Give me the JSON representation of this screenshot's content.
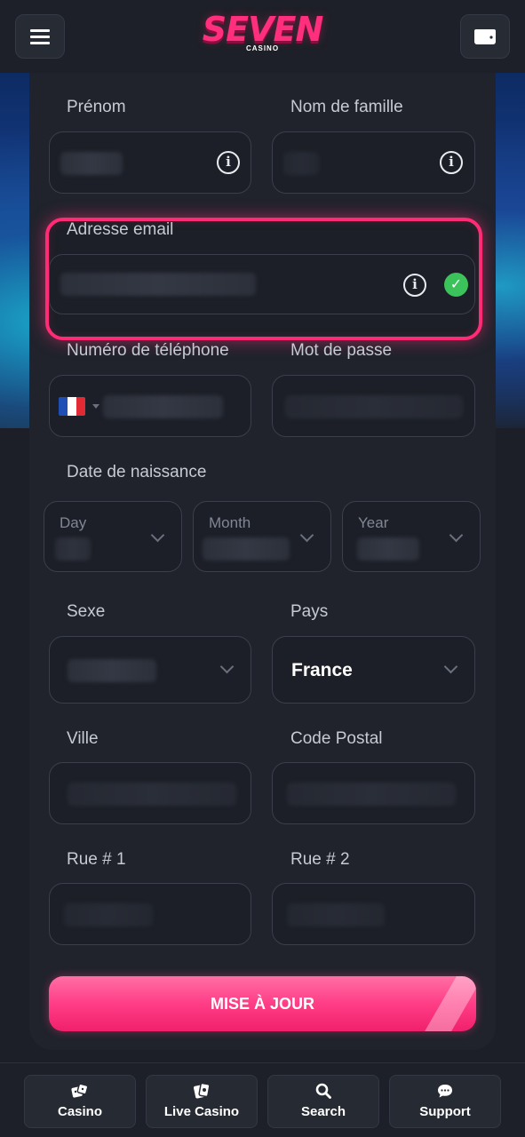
{
  "header": {
    "logo_main": "SEVEN",
    "logo_sub": "CASINO",
    "menu_icon": "hamburger-icon",
    "wallet_icon": "wallet-icon"
  },
  "form": {
    "first_name_label": "Prénom",
    "last_name_label": "Nom de famille",
    "email_label": "Adresse email",
    "phone_label": "Numéro de téléphone",
    "password_label": "Mot de passe",
    "dob_label": "Date de naissance",
    "day_label": "Day",
    "month_label": "Month",
    "year_label": "Year",
    "sex_label": "Sexe",
    "country_label": "Pays",
    "country_value": "France",
    "city_label": "Ville",
    "postal_label": "Code Postal",
    "street1_label": "Rue # 1",
    "street2_label": "Rue # 2",
    "submit_label": "MISE À JOUR"
  },
  "colors": {
    "accent": "#ff2b74",
    "success": "#3cc25a",
    "background": "#1c1f27"
  },
  "bottom_nav": [
    {
      "label": "Casino",
      "icon": "dice-icon"
    },
    {
      "label": "Live Casino",
      "icon": "cards-icon"
    },
    {
      "label": "Search",
      "icon": "search-icon"
    },
    {
      "label": "Support",
      "icon": "chat-icon"
    }
  ]
}
